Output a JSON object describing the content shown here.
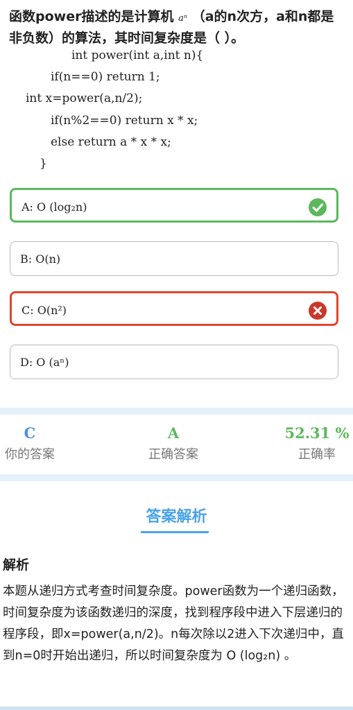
{
  "question": {
    "part1": "函数power描述的是计算机 ",
    "math": "aⁿ",
    "part2": " （a的n次方，a和n都是非负数）的算法，其时间复杂度是（ ）。"
  },
  "code": [
    "int power(int a,int n){",
    "if(n==0) return 1;",
    "int x=power(a,n/2);",
    "if(n%2==0) return x * x;",
    "else return a * x * x;",
    "}"
  ],
  "options": [
    {
      "label": "A:  O (log₂n)",
      "state": "correct"
    },
    {
      "label": "B: O(n)",
      "state": "normal"
    },
    {
      "label": "C:  O(n²)",
      "state": "wrong"
    },
    {
      "label": "D:  O (aⁿ)",
      "state": "normal"
    }
  ],
  "stats": {
    "your_answer": "C",
    "your_answer_label": "你的答案",
    "correct_answer": "A",
    "correct_answer_label": "正确答案",
    "accuracy": "52.31 %",
    "accuracy_label": "正确率"
  },
  "analysis_tab": "答案解析",
  "explanation": {
    "heading": "解析",
    "body": "本题从递归方式考查时间复杂度。power函数为一个递归函数，时间复杂度为该函数递归的深度，找到程序段中进入下层递归的程序段，即x=power(a,n/2)。n每次除以2进入下次递归中，直到n=0时开始出递归，所以时间复杂度为 O (log₂n) 。"
  },
  "colors": {
    "correct": "#5cb85c",
    "wrong": "#e0452f",
    "your_answer": "#4a8fe0",
    "accent": "#4aa3ea"
  }
}
